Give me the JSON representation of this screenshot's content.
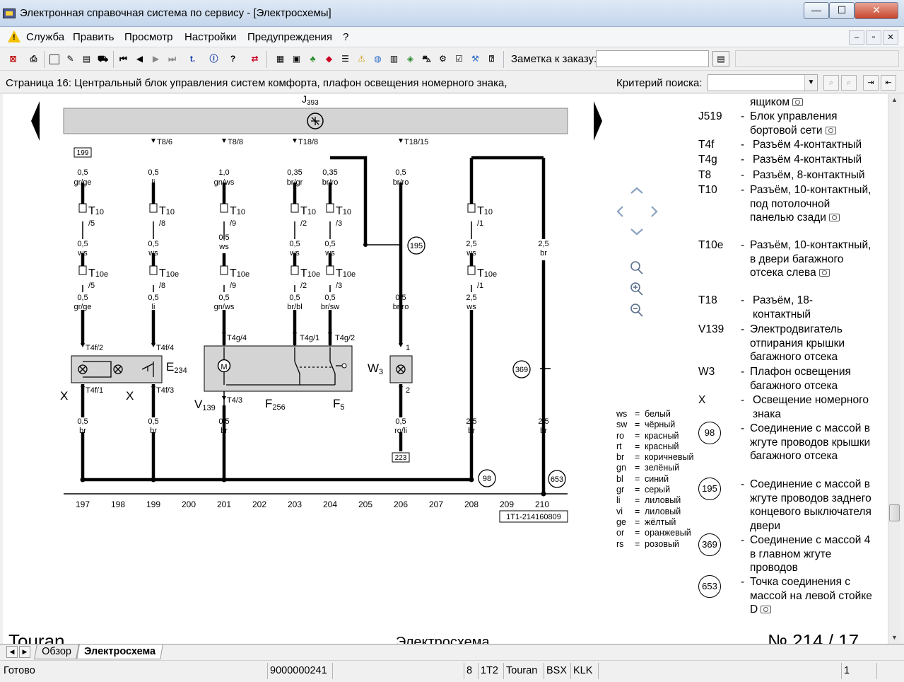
{
  "window": {
    "title": "Электронная справочная система по сервису - [Электросхемы]",
    "min_symbol": "—",
    "max_symbol": "☐",
    "close_symbol": "✕"
  },
  "menu": {
    "items": [
      "Служба",
      "Править",
      "Просмотр",
      "Настройки",
      "Предупреждения",
      "?"
    ],
    "mdi_min": "–",
    "mdi_restore": "▫",
    "mdi_close": "✕"
  },
  "toolbar": {
    "order_label": "Заметка к заказу:",
    "order_value": ""
  },
  "pagebar": {
    "page_text": "Страница 16: Центральный блок управления систем комфорта, плафон освещения номерного знака,",
    "criteria_label": "Критерий поиска:",
    "criteria_value": ""
  },
  "diagram": {
    "control_unit": "J",
    "control_unit_sub": "393",
    "top_pins": [
      "T8/6",
      "T8/8",
      "T18/8",
      "T18/15"
    ],
    "ref_top": "199",
    "ref_bottom": "223",
    "columns": [
      "197",
      "198",
      "199",
      "200",
      "201",
      "202",
      "203",
      "204",
      "205",
      "206",
      "207",
      "208",
      "209",
      "210"
    ],
    "code": "1T1-214160809",
    "comp_e": "E",
    "comp_e_sub": "234",
    "comp_x": "X",
    "comp_v": "V",
    "comp_v_sub": "139",
    "comp_f256": "F",
    "comp_f256_sub": "256",
    "comp_f5": "F",
    "comp_f5_sub": "5",
    "comp_w": "W",
    "comp_w_sub": "3",
    "conn_t10": "T",
    "conn_t10_sub": "10",
    "conn_t10e": "T",
    "conn_t10e_sub": "10e",
    "motor_label": "M",
    "ground_195": "195",
    "ground_369": "369",
    "ground_98": "98",
    "ground_653": "653",
    "pins": {
      "t10_5": "/5",
      "t10_8": "/8",
      "t10_9": "/9",
      "t10_2": "/2",
      "t10_3": "/3",
      "t10_1": "/1",
      "t4f2": "T4f/2",
      "t4f4": "T4f/4",
      "t4f1": "T4f/1",
      "t4f3": "T4f/3",
      "t4g4": "T4g/4",
      "t4g1": "T4g/1",
      "t4g2": "T4g/2",
      "t43": "T4/3",
      "w1": "1",
      "w2": "2"
    },
    "wires": {
      "c197a": [
        "0,5",
        "gr/ge"
      ],
      "c199a": [
        "0,5",
        "li"
      ],
      "c201a": [
        "1,0",
        "gn/ws"
      ],
      "c203a": [
        "0,35",
        "br/gr"
      ],
      "c204a": [
        "0,35",
        "br/ro"
      ],
      "c206a": [
        "0,5",
        "br/ro"
      ],
      "c197b": [
        "0,5",
        "ws"
      ],
      "c199b": [
        "0,5",
        "ws"
      ],
      "c201b": [
        "0,5",
        "ws"
      ],
      "c203b": [
        "0,5",
        "ws"
      ],
      "c204b": [
        "0,5",
        "ws"
      ],
      "c208b": [
        "2,5",
        "ws"
      ],
      "c210b": [
        "2,5",
        "br"
      ],
      "c197c": [
        "0,5",
        "gr/ge"
      ],
      "c199c": [
        "0,5",
        "li"
      ],
      "c201c": [
        "0,5",
        "gn/ws"
      ],
      "c203c": [
        "0,5",
        "br/bl"
      ],
      "c204c": [
        "0,5",
        "br/sw"
      ],
      "c206c": [
        "0,5",
        "br/ro"
      ],
      "c208c": [
        "2,5",
        "ws"
      ],
      "c197d": [
        "0,5",
        "br"
      ],
      "c199d": [
        "0,5",
        "br"
      ],
      "c201d": [
        "0,5",
        "br"
      ],
      "c206d": [
        "0,5",
        "ro/li"
      ],
      "c208d": [
        "2,5",
        "br"
      ],
      "c210d": [
        "2,5",
        "br"
      ]
    }
  },
  "color_key": [
    {
      "code": "ws",
      "name": "белый"
    },
    {
      "code": "sw",
      "name": "чёрный"
    },
    {
      "code": "ro",
      "name": "красный"
    },
    {
      "code": "rt",
      "name": "красный"
    },
    {
      "code": "br",
      "name": "коричневый"
    },
    {
      "code": "gn",
      "name": "зелёный"
    },
    {
      "code": "bl",
      "name": "синий"
    },
    {
      "code": "gr",
      "name": "серый"
    },
    {
      "code": "li",
      "name": "лиловый"
    },
    {
      "code": "vi",
      "name": "лиловый"
    },
    {
      "code": "ge",
      "name": "жёлтый"
    },
    {
      "code": "or",
      "name": "оранжевый"
    },
    {
      "code": "rs",
      "name": "розовый"
    }
  ],
  "legend": [
    {
      "code": "",
      "desc": "ящиком",
      "cam": true
    },
    {
      "code": "J519",
      "desc": "Блок управления бортовой сети",
      "cam": true
    },
    {
      "code": "T4f",
      "desc": "Разъём 4-контактный",
      "cam": false
    },
    {
      "code": "T4g",
      "desc": "Разъём 4-контактный",
      "cam": false
    },
    {
      "code": "T8",
      "desc": "Разъём, 8-контактный",
      "cam": false
    },
    {
      "code": "T10",
      "desc": "Разъём, 10-контактный, под потолочной панелью сзади",
      "cam": true
    },
    {
      "code": "T10e",
      "desc": "Разъём, 10-контактный, в двери багажного отсека слева",
      "cam": true
    },
    {
      "code": "T18",
      "desc": "Разъём, 18-контактный",
      "cam": false
    },
    {
      "code": "V139",
      "desc": "Электродвигатель отпирания крышки багажного отсека",
      "cam": false
    },
    {
      "code": "W3",
      "desc": "Плафон освещения багажного отсека",
      "cam": false
    },
    {
      "code": "X",
      "desc": "Освещение номерного знака",
      "cam": false
    },
    {
      "code": "98",
      "desc": "Соединение с массой в жгуте проводов крышки багажного отсека",
      "cam": false
    },
    {
      "code": "195",
      "desc": "Соединение с массой в жгуте проводов заднего концевого выключателя двери",
      "cam": false
    },
    {
      "code": "369",
      "desc": "Соединение с массой 4 в главном жгуте проводов",
      "cam": false
    },
    {
      "code": "653",
      "desc": "Точка соединения с массой на левой стойке D",
      "cam": true
    }
  ],
  "footer": {
    "left": "Touran",
    "center": "Электросхема",
    "right": "№ 214 / 17"
  },
  "tabs": [
    {
      "label": "Обзор",
      "active": false
    },
    {
      "label": "Электросхема",
      "active": true
    }
  ],
  "status": {
    "state": "Готово",
    "id": "9000000241",
    "f1": "8",
    "f2": "1T2",
    "f3": "Touran",
    "f4": "BSX",
    "f5": "KLK",
    "page": "1"
  }
}
